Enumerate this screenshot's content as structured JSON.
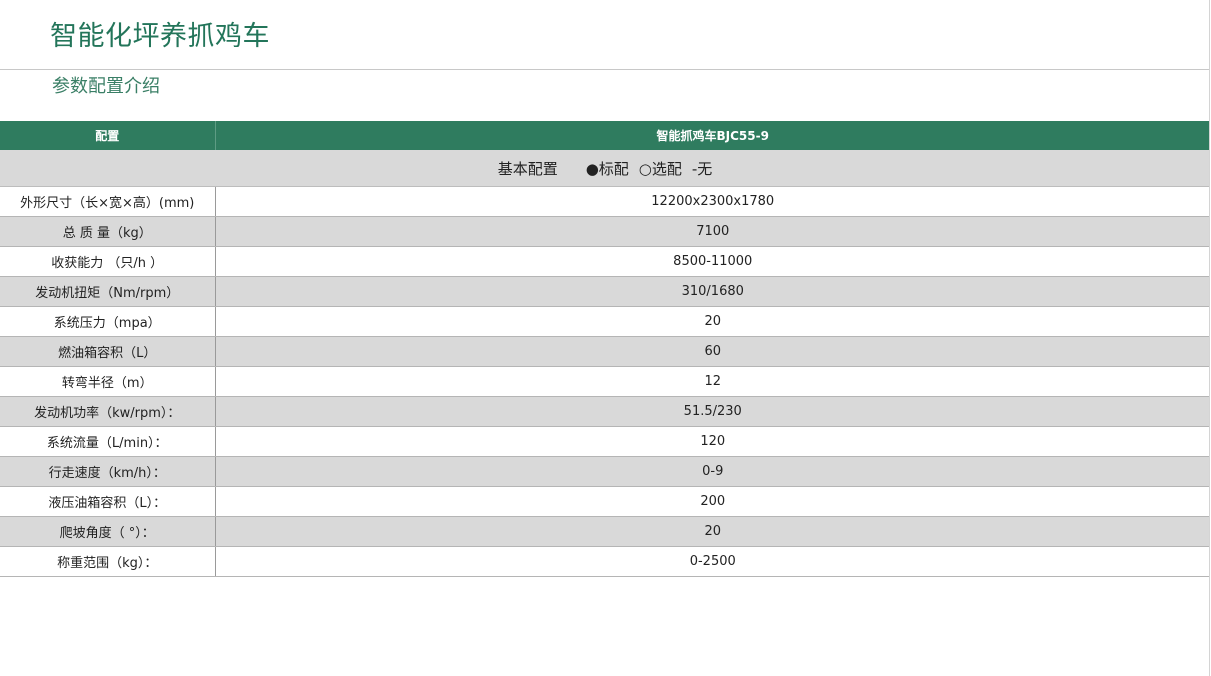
{
  "page": {
    "title": "智能化坪养抓鸡车",
    "section_title": "参数配置介绍"
  },
  "table": {
    "header": {
      "col1": "配置",
      "col2": "智能抓鸡车BJC55-9"
    },
    "group": {
      "label": "基本配置",
      "legend_standard": "●标配",
      "legend_optional": "○选配",
      "legend_none": "-无"
    },
    "rows": [
      {
        "label": "外形尺寸（长×宽×高）(mm)",
        "value": "12200x2300x1780"
      },
      {
        "label": "总 质 量（kg）",
        "value": "7100"
      },
      {
        "label": "收获能力 （只/h ）",
        "value": "8500-11000"
      },
      {
        "label": "发动机扭矩（Nm/rpm）",
        "value": "310/1680"
      },
      {
        "label": "系统压力（mpa）",
        "value": "20"
      },
      {
        "label": "燃油箱容积（L）",
        "value": "60"
      },
      {
        "label": "转弯半径（m）",
        "value": "12"
      },
      {
        "label": "发动机功率（kw/rpm）：",
        "value": "51.5/230"
      },
      {
        "label": "系统流量（L/min）：",
        "value": "120"
      },
      {
        "label": "行走速度（km/h）：",
        "value": "0-9"
      },
      {
        "label": "液压油箱容积（L）：",
        "value": "200"
      },
      {
        "label": "爬坡角度（ °）：",
        "value": "20"
      },
      {
        "label": "称重范围（kg）：",
        "value": "0-2500"
      }
    ]
  }
}
